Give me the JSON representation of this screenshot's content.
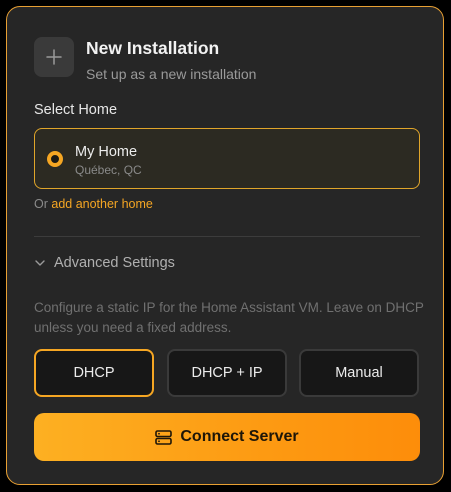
{
  "header": {
    "title": "New Installation",
    "subtitle": "Set up as a new installation",
    "icon": "plus-icon"
  },
  "home_section": {
    "label": "Select Home",
    "selected_home": {
      "name": "My Home",
      "location": "Québec, QC",
      "selected": true
    },
    "or_prefix": "Or",
    "add_link": "add another home"
  },
  "advanced": {
    "label": "Advanced Settings",
    "expanded": true,
    "description": "Configure a static IP for the Home Assistant VM. Leave on DHCP unless you need a fixed address.",
    "options": [
      "DHCP",
      "DHCP + IP",
      "Manual"
    ],
    "selected_option": "DHCP"
  },
  "actions": {
    "connect_label": "Connect Server",
    "connect_icon": "server-icon"
  },
  "colors": {
    "accent": "#f5a623",
    "card_background": "#262626",
    "button_gradient_start": "#fdb022",
    "button_gradient_end": "#fd8d0a"
  }
}
